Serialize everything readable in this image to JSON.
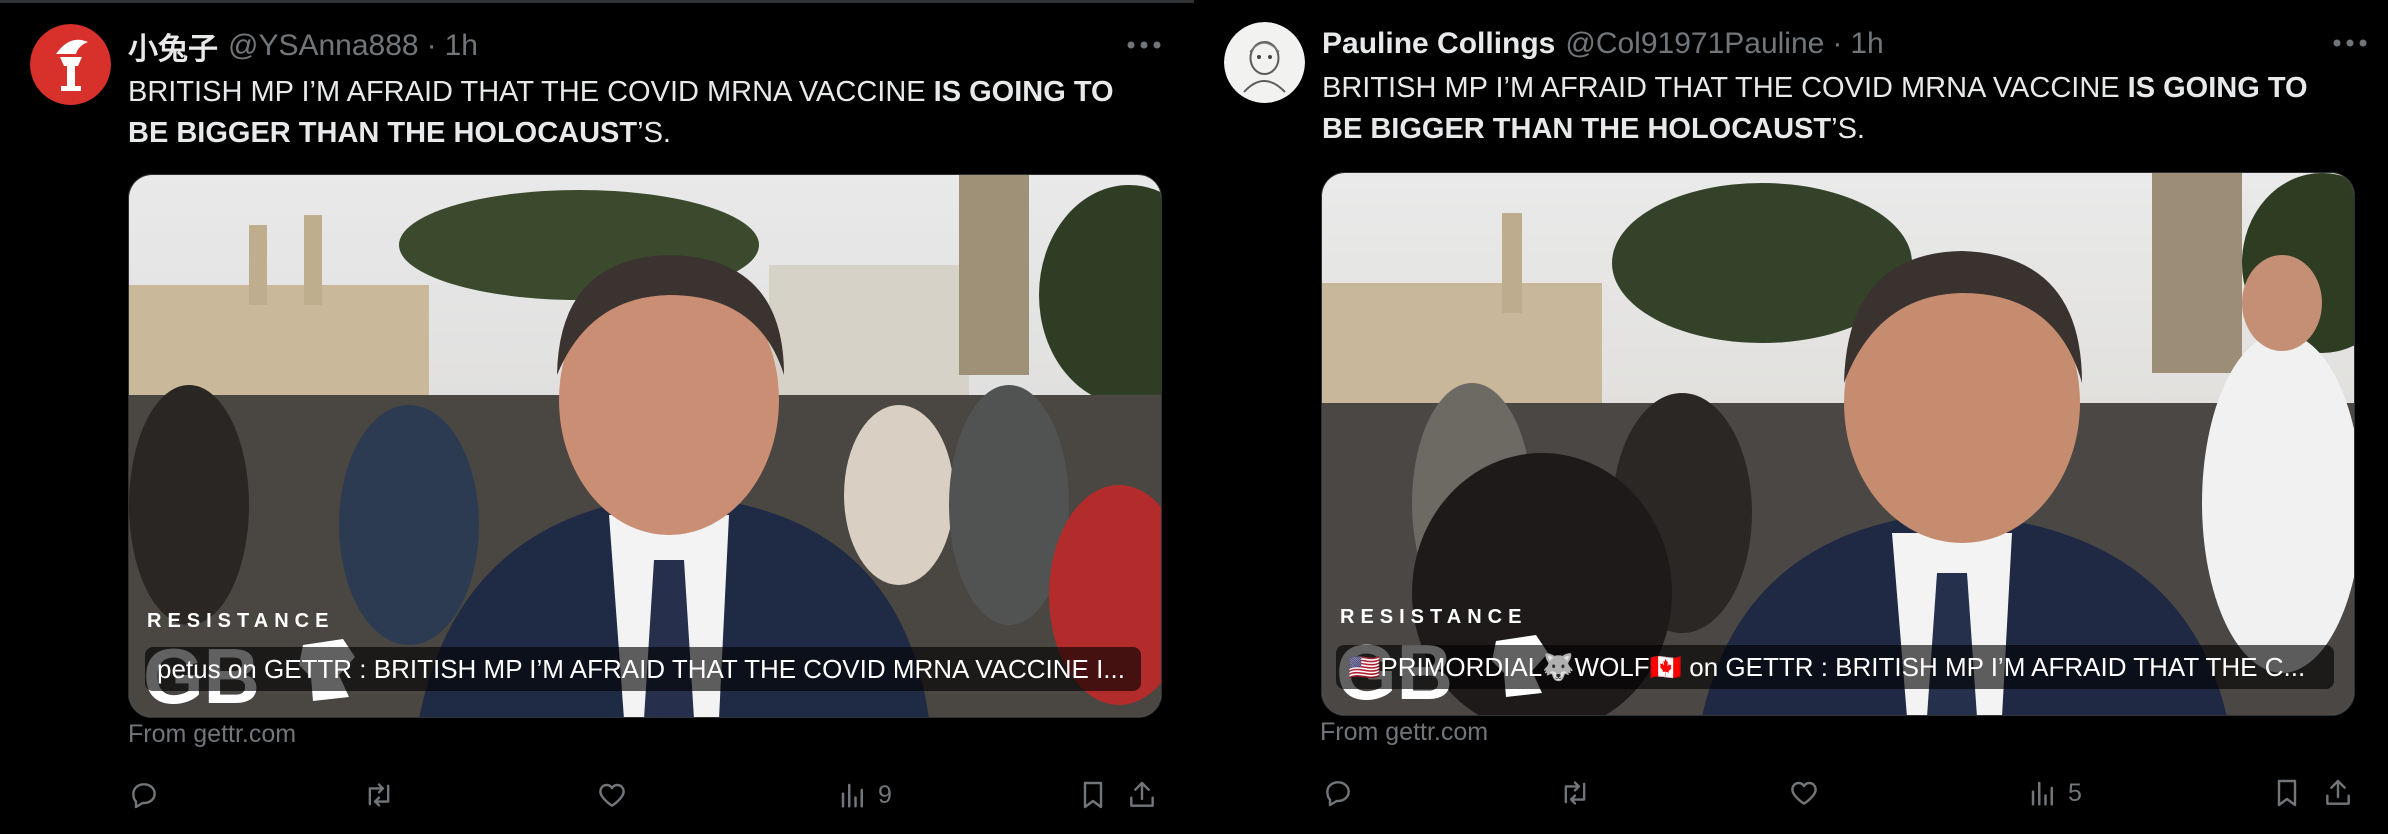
{
  "colors": {
    "background": "#000000",
    "text_primary": "#e7e9ea",
    "text_secondary": "#71767b",
    "divider": "#2f3336"
  },
  "tweets": [
    {
      "display_name": "小兔子",
      "handle": "@YSAnna888",
      "separator": "·",
      "time": "1h",
      "avatar_icon": "torch-logo-icon",
      "text_part1": "BRITISH MP I’M AFRAID THAT THE COVID MRNA VACCINE ",
      "text_bold": "IS GOING TO BE BIGGER THAN THE HOLOCAUST",
      "text_part2": "’S.",
      "media_logo_top": "RESISTANCE",
      "media_logo_bottom": "GB",
      "media_caption": "petus on GETTR : BRITISH MP I’M AFRAID THAT THE COVID MRNA VACCINE I...",
      "source": "From gettr.com",
      "views": "9"
    },
    {
      "display_name": "Pauline Collings",
      "handle": "@Col91971Pauline",
      "separator": "·",
      "time": "1h",
      "avatar_icon": "portrait-sketch-icon",
      "text_part1": "BRITISH MP I’M AFRAID THAT THE COVID MRNA VACCINE ",
      "text_bold": "IS GOING TO BE BIGGER THAN THE HOLOCAUST",
      "text_part2": "’S.",
      "media_logo_top": "RESISTANCE",
      "media_logo_bottom": "GB",
      "media_caption": "🇺🇸PRIMORDIAL🐺WOLF🇨🇦 on GETTR : BRITISH MP I’M AFRAID THAT THE C...",
      "source": "From gettr.com",
      "views": "5"
    }
  ]
}
